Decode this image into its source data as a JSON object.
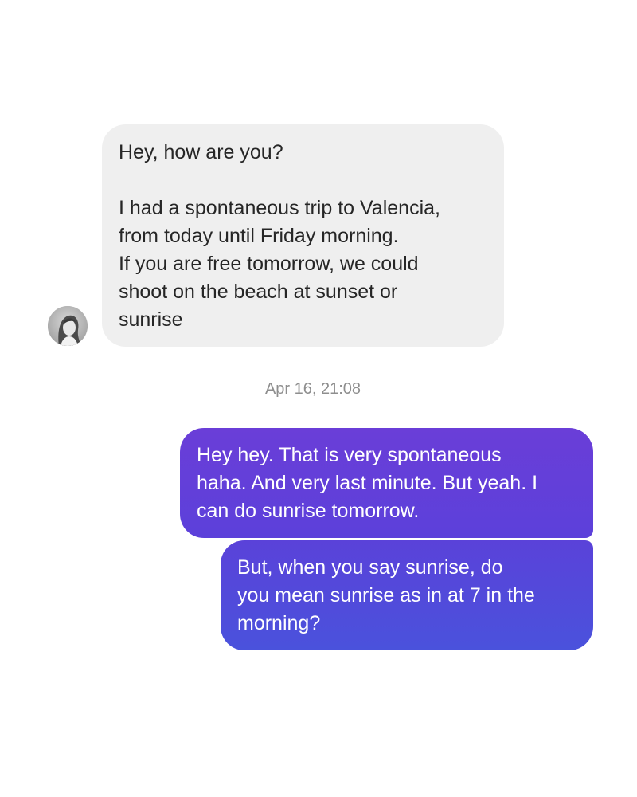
{
  "thread": {
    "incoming": {
      "greeting": "Hey, how are you?",
      "body": "I had a spontaneous trip to Valencia,\nfrom today until Friday morning.\nIf you are free tomorrow, we could\nshoot on the beach at sunset or\nsunrise"
    },
    "timestamp": "Apr 16, 21:08",
    "outgoing": [
      {
        "text": "Hey hey. That is very spontaneous\nhaha. And very last minute. But yeah. I\ncan do sunrise tomorrow."
      },
      {
        "text": "But, when you say sunrise, do\nyou mean sunrise as in at 7 in the\nmorning?"
      }
    ]
  },
  "colors": {
    "incoming_bubble": "#efefef",
    "outgoing_gradient_start": "#6a3ed8",
    "outgoing_gradient_end": "#4a52dc",
    "timestamp_text": "#8e8e8e"
  },
  "icons": {
    "avatar": "profile-photo-avatar"
  }
}
